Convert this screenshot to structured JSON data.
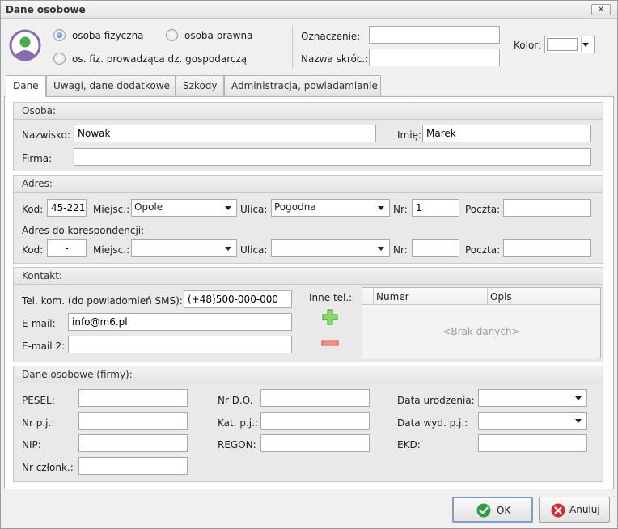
{
  "window": {
    "title": "Dane osobowe",
    "close_glyph": "✕"
  },
  "header": {
    "person_type": {
      "options": [
        {
          "label": "osoba fizyczna",
          "selected": true
        },
        {
          "label": "osoba prawna",
          "selected": false
        },
        {
          "label": "os. fiz. prowadząca dz. gospodarczą",
          "selected": false
        }
      ]
    },
    "oznaczenie_label": "Oznaczenie:",
    "oznaczenie_value": "",
    "nazwa_label": "Nazwa skróc.:",
    "nazwa_value": "",
    "kolor_label": "Kolor:",
    "kolor_value": "#ffffff",
    "avatar_icon": "user-avatar-icon"
  },
  "tabs": [
    {
      "label": "Dane",
      "active": true
    },
    {
      "label": "Uwagi, dane dodatkowe",
      "active": false
    },
    {
      "label": "Szkody",
      "active": false
    },
    {
      "label": "Administracja, powiadamianie",
      "active": false
    }
  ],
  "osoba": {
    "title": "Osoba:",
    "nazwisko_label": "Nazwisko:",
    "nazwisko_value": "Nowak",
    "imie_label": "Imię:",
    "imie_value": "Marek",
    "firma_label": "Firma:",
    "firma_value": ""
  },
  "adres": {
    "title": "Adres:",
    "kod_label": "Kod:",
    "kod_value": "45-221",
    "miejsc_label": "Miejsc.:",
    "miejsc_value": "Opole",
    "ulica_label": "Ulica:",
    "ulica_value": "Pogodna",
    "nr_label": "Nr:",
    "nr_value": "1",
    "poczta_label": "Poczta:",
    "poczta_value": "",
    "koresp_label": "Adres do korespondencji:",
    "koresp_kod_value": "-",
    "koresp_miejsc_value": "",
    "koresp_ulica_value": "",
    "koresp_nr_value": "",
    "koresp_poczta_value": ""
  },
  "kontakt": {
    "title": "Kontakt:",
    "telkom_label": "Tel. kom. (do powiadomień SMS):",
    "telkom_value": "(+48)500-000-000",
    "email_label": "E-mail:",
    "email_value": "info@m6.pl",
    "email2_label": "E-mail 2:",
    "email2_value": "",
    "inne_tel_label": "Inne tel.:",
    "add_icon": "plus-icon",
    "remove_icon": "minus-icon",
    "grid": {
      "columns": [
        "Numer",
        "Opis"
      ],
      "empty_text": "<Brak danych>"
    }
  },
  "firma": {
    "title": "Dane osobowe (firmy):",
    "pesel_label": "PESEL:",
    "pesel_value": "",
    "nrdo_label": "Nr D.O.",
    "nrdo_value": "",
    "dataur_label": "Data urodzenia:",
    "dataur_value": "",
    "nrpj_label": "Nr p.j.:",
    "nrpj_value": "",
    "katpj_label": "Kat. p.j.:",
    "katpj_value": "",
    "datawyd_label": "Data wyd. p.j.:",
    "datawyd_value": "",
    "nip_label": "NIP:",
    "nip_value": "",
    "regon_label": "REGON:",
    "regon_value": "",
    "ekd_label": "EKD:",
    "ekd_value": "",
    "nrczlonk_label": "Nr członk.:",
    "nrczlonk_value": ""
  },
  "buttons": {
    "ok_label": "OK",
    "ok_icon": "check-icon",
    "cancel_label": "Anuluj",
    "cancel_icon": "cancel-icon"
  }
}
